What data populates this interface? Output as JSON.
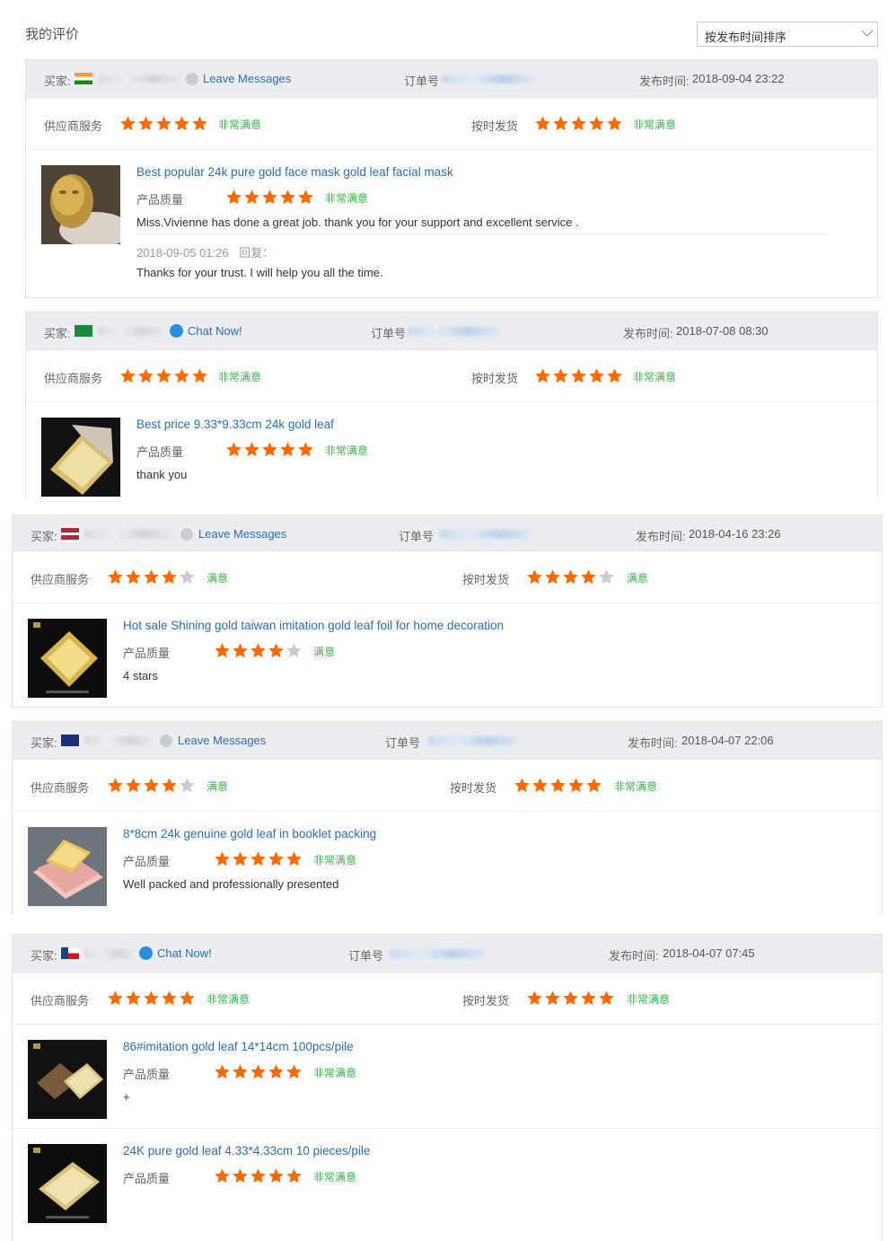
{
  "page": {
    "title": "我的评价"
  },
  "sort": {
    "label": "按发布时间排序"
  },
  "labels": {
    "buyer": "买家:",
    "order": "订单号",
    "date_prefix": "发布时间:",
    "supplier_service": "供应商服务",
    "on_time_shipping": "按时发货",
    "product_quality": "产品质量",
    "reply": "回复："
  },
  "colors": {
    "star": "#ff6a00",
    "star_empty": "#cccccc",
    "satisfaction": "#3bb54a",
    "link": "#2d6db5"
  },
  "reviews": [
    {
      "flag": "india",
      "contact": "Leave Messages",
      "contact_icon": "message-icon",
      "date": "2018-09-04 23:22",
      "supplier_rating": 5,
      "supplier_label": "非常满意",
      "shipping_rating": 5,
      "shipping_label": "非常满意",
      "products": [
        {
          "title": "Best popular 24k pure gold face mask gold leaf facial mask",
          "rating": 5,
          "rating_label": "非常满意",
          "comment": "Miss.Vivienne has done a great job. thank you for your support and excellent service .",
          "reply_date": "2018-09-05 01:26",
          "reply_text": "Thanks for your trust. I will help you all the time.",
          "image": "gold-face-mask"
        }
      ]
    },
    {
      "flag": "saudi-arabia",
      "contact": "Chat Now!",
      "contact_icon": "chat-icon",
      "date": "2018-07-08 08:30",
      "supplier_rating": 5,
      "supplier_label": "非常满意",
      "shipping_rating": 5,
      "shipping_label": "非常满意",
      "products": [
        {
          "title": "Best price 9.33*9.33cm 24k gold leaf",
          "rating": 5,
          "rating_label": "非常满意",
          "comment": "thank you",
          "image": "gold-leaf-sheet"
        }
      ]
    },
    {
      "flag": "latvia",
      "contact": "Leave Messages",
      "contact_icon": "message-icon",
      "date": "2018-04-16 23:26",
      "supplier_rating": 4,
      "supplier_label": "满意",
      "shipping_rating": 4,
      "shipping_label": "满意",
      "products": [
        {
          "title": "Hot sale Shining gold taiwan imitation gold leaf foil for home decoration",
          "rating": 4,
          "rating_label": "满意",
          "comment": "4 stars",
          "image": "gold-leaf-sheet"
        }
      ]
    },
    {
      "flag": "australia",
      "contact": "Leave Messages",
      "contact_icon": "message-icon",
      "date": "2018-04-07 22:06",
      "supplier_rating": 4,
      "supplier_label": "满意",
      "shipping_rating": 5,
      "shipping_label": "非常满意",
      "products": [
        {
          "title": "8*8cm 24k genuine gold leaf in booklet packing",
          "rating": 5,
          "rating_label": "非常满意",
          "comment": "Well packed and professionally presented",
          "image": "gold-leaf-booklet"
        }
      ]
    },
    {
      "flag": "czech",
      "contact": "Chat Now!",
      "contact_icon": "chat-icon",
      "date": "2018-04-07 07:45",
      "supplier_rating": 5,
      "supplier_label": "非常满意",
      "shipping_rating": 5,
      "shipping_label": "非常满意",
      "products": [
        {
          "title": "86#imitation gold leaf 14*14cm 100pcs/pile",
          "rating": 5,
          "rating_label": "非常满意",
          "comment": "+",
          "image": "gold-leaf-pile"
        },
        {
          "title": "24K pure gold leaf 4.33*4.33cm 10 pieces/pile",
          "rating": 5,
          "rating_label": "非常满意",
          "comment": "",
          "image": "gold-leaf-sheet"
        }
      ]
    }
  ]
}
